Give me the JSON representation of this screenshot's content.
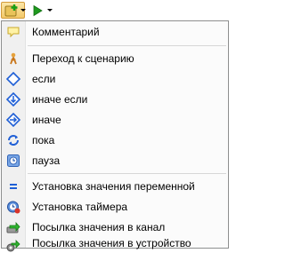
{
  "toolbar": {
    "add_button_icon": "add-plus-icon",
    "run_button_icon": "play-icon"
  },
  "menu": {
    "items": [
      {
        "label": "Комментарий",
        "icon": "comment-icon"
      },
      {
        "label": "Переход к сценарию",
        "icon": "goto-scenario-icon"
      },
      {
        "label": "если",
        "icon": "if-diamond-icon"
      },
      {
        "label": "иначе если",
        "icon": "else-if-diamond-icon"
      },
      {
        "label": "иначе",
        "icon": "else-diamond-icon"
      },
      {
        "label": "пока",
        "icon": "loop-icon"
      },
      {
        "label": "пауза",
        "icon": "pause-icon"
      },
      {
        "label": "Установка значения переменной",
        "icon": "set-variable-icon"
      },
      {
        "label": "Установка таймера",
        "icon": "timer-icon"
      },
      {
        "label": "Посылка значения в канал",
        "icon": "send-to-channel-icon"
      },
      {
        "label": "Посылка значения в устройство",
        "icon": "send-to-device-icon"
      }
    ]
  },
  "colors": {
    "accent_blue": "#1f5fd6",
    "play_green": "#1e9a1e",
    "gutter": "#f0f0f0",
    "border": "#8e8f8f"
  }
}
